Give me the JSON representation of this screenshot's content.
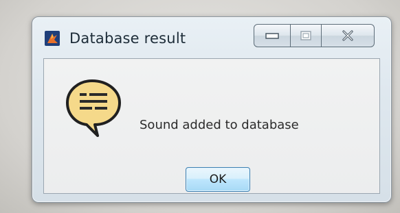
{
  "window": {
    "title": "Database result",
    "app_icon": "app-logo-icon",
    "caption_buttons": {
      "minimize_icon": "minimize-icon",
      "maximize_icon": "maximize-icon",
      "close_icon": "close-icon"
    }
  },
  "dialog": {
    "icon": "speech-bubble-info-icon",
    "message": "Sound added to database",
    "ok_label": "OK"
  },
  "colors": {
    "ok_button_border": "#3c7fb1",
    "ok_button_fill": "#bee6fd",
    "info_bubble_fill": "#f5d98a",
    "close_glyph": "#4a5864"
  }
}
